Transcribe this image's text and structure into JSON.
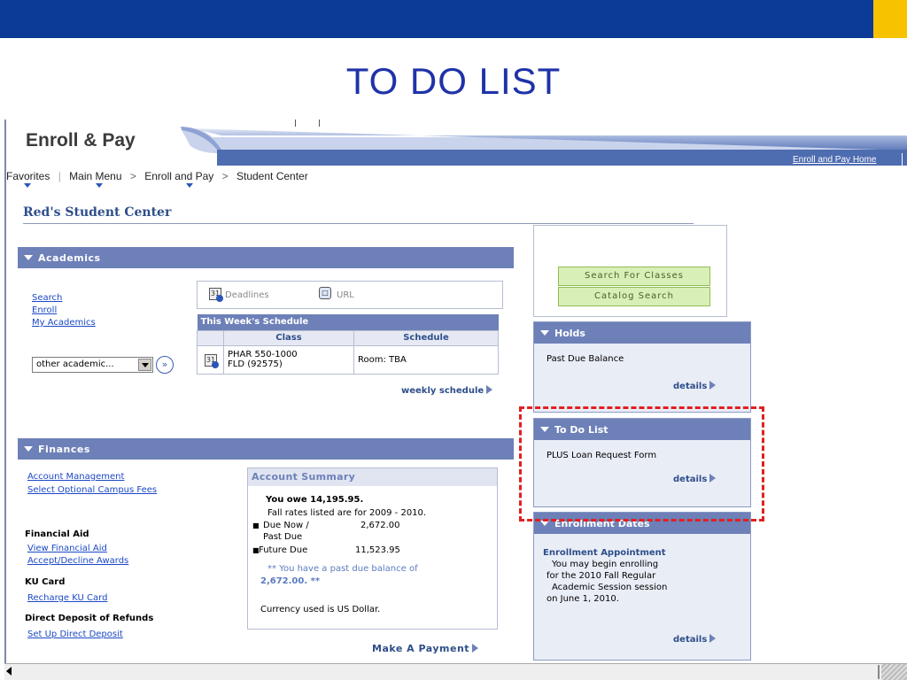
{
  "slide": {
    "title": "TO DO LIST",
    "colors": {
      "top_bar": "#0b3b96",
      "accent": "#f7c300",
      "title": "#1f33a8",
      "highlight_box": "#e02020"
    }
  },
  "app": {
    "title": "Enroll & Pay",
    "home_link": "Enroll and Pay Home"
  },
  "breadcrumb": {
    "items": [
      "Favorites",
      "Main Menu",
      "Enroll and Pay",
      "Student Center"
    ]
  },
  "student_center": {
    "title": "Red's Student Center"
  },
  "academics": {
    "header": "Academics",
    "links": [
      "Search",
      "Enroll",
      "My Academics"
    ],
    "dropdown_value": "other academic...",
    "deadlines_label": "Deadlines",
    "url_label": "URL",
    "schedule": {
      "caption": "This Week's Schedule",
      "columns": [
        "Class",
        "Schedule"
      ],
      "rows": [
        {
          "class_line1": "PHAR 550-1000",
          "class_line2": "FLD (92575)",
          "schedule": "Room:  TBA"
        }
      ]
    },
    "weekly_schedule_link": "weekly schedule"
  },
  "finances": {
    "header": "Finances",
    "links": [
      "Account Management",
      "Select Optional Campus Fees"
    ],
    "financial_aid": {
      "heading": "Financial Aid",
      "links": [
        "View Financial Aid",
        "Accept/Decline Awards"
      ]
    },
    "ku_card": {
      "heading": "KU Card",
      "links": [
        "Recharge KU Card"
      ]
    },
    "direct_deposit": {
      "heading": "Direct Deposit of Refunds",
      "links": [
        "Set Up Direct Deposit"
      ]
    },
    "account_summary": {
      "header": "Account Summary",
      "owe": "You owe 14,195.95.",
      "rates_note": "Fall rates listed are for 2009 - 2010.",
      "due_now_label_1": "Due Now /",
      "due_now_label_2": "Past Due",
      "due_now_amount": "2,672.00",
      "future_due_label": "Future Due",
      "future_due_amount": "11,523.95",
      "past_due_line1": "** You have a past due balance of",
      "past_due_line2": "2,672.00. **",
      "currency": "Currency used is US Dollar.",
      "make_payment": "Make A Payment"
    }
  },
  "right_column": {
    "search_classes": "Search For Classes",
    "catalog_search": "Catalog Search",
    "holds": {
      "header": "Holds",
      "item": "Past Due Balance",
      "details": "details"
    },
    "todo": {
      "header": "To Do List",
      "item": "PLUS Loan Request Form",
      "details": "details"
    },
    "enrollment": {
      "header": "Enrollment Dates",
      "appointment_heading": "Enrollment Appointment",
      "lines": [
        "You may begin enrolling",
        "for the 2010 Fall Regular",
        "Academic Session session",
        "on June 1, 2010."
      ],
      "details": "details"
    }
  }
}
